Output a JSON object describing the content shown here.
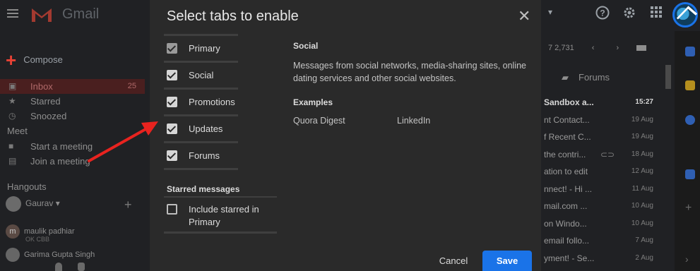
{
  "app": {
    "name": "Gmail"
  },
  "background": {
    "compose_label": "Compose",
    "nav": [
      {
        "label": "Inbox",
        "count": "25"
      },
      {
        "label": "Starred"
      },
      {
        "label": "Snoozed"
      }
    ],
    "meet_heading": "Meet",
    "meet_items": [
      "Start a meeting",
      "Join a meeting"
    ],
    "hangouts_heading": "Hangouts",
    "hangouts_user": "Gaurav",
    "contacts": [
      {
        "initial": "m",
        "name": "maulik padhiar",
        "status": "OK CBB"
      },
      {
        "initial": "",
        "name": "Garima Gupta Singh",
        "status": ""
      }
    ],
    "pager_text": "7 2,731",
    "forums_tab": "Forums",
    "mail_rows": [
      {
        "subject": "Sandbox a...",
        "date": "15:27",
        "bold": true
      },
      {
        "subject": "nt Contact...",
        "date": "19 Aug"
      },
      {
        "subject": "f Recent C...",
        "date": "19 Aug"
      },
      {
        "subject": "the contri...",
        "date": "18 Aug"
      },
      {
        "subject": "ation to edit",
        "date": "12 Aug"
      },
      {
        "subject": "nnect! - Hi ...",
        "date": "11 Aug"
      },
      {
        "subject": "mail.com ...",
        "date": "10 Aug"
      },
      {
        "subject": "on Windo...",
        "date": "10 Aug"
      },
      {
        "subject": "email follo...",
        "date": "7 Aug"
      },
      {
        "subject": "yment! - Se...",
        "date": "2 Aug"
      }
    ]
  },
  "dialog": {
    "title": "Select tabs to enable",
    "tabs": [
      {
        "label": "Primary",
        "checked": true,
        "disabled": true
      },
      {
        "label": "Social",
        "checked": true
      },
      {
        "label": "Promotions",
        "checked": true
      },
      {
        "label": "Updates",
        "checked": true
      },
      {
        "label": "Forums",
        "checked": true
      }
    ],
    "starred_heading": "Starred messages",
    "starred_option": "Include starred in Primary",
    "detail": {
      "title": "Social",
      "description": "Messages from social networks, media-sharing sites, online dating services and other social websites.",
      "examples_heading": "Examples",
      "examples": [
        "Quora Digest",
        "LinkedIn"
      ]
    },
    "cancel_label": "Cancel",
    "save_label": "Save"
  },
  "colors": {
    "accent": "#1a73e8",
    "annotation_arrow": "#e8231f"
  }
}
